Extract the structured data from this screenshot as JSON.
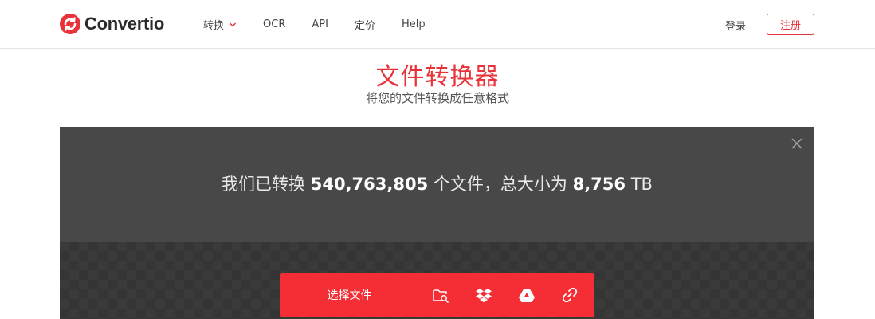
{
  "brand": {
    "name": "Convertio",
    "color": "#e8333a"
  },
  "nav": {
    "items": [
      {
        "label": "转换",
        "has_dropdown": true
      },
      {
        "label": "OCR"
      },
      {
        "label": "API"
      },
      {
        "label": "定价"
      },
      {
        "label": "Help"
      }
    ],
    "login_label": "登录",
    "register_label": "注册"
  },
  "hero": {
    "title": "文件转换器",
    "subtitle": "将您的文件转换成任意格式"
  },
  "stats": {
    "prefix": "我们已转换",
    "files_count": "540,763,805",
    "middle": "个文件，总大小为",
    "total_size": "8,756",
    "unit": "TB"
  },
  "upload": {
    "choose_label": "选择文件",
    "sources": [
      {
        "icon": "folder-search-icon"
      },
      {
        "icon": "dropbox-icon"
      },
      {
        "icon": "google-drive-icon"
      },
      {
        "icon": "url-link-icon"
      }
    ],
    "bar_color": "#f52d35"
  },
  "colors": {
    "stats_panel": "#484848",
    "dark_area": "#3a3a3a"
  }
}
